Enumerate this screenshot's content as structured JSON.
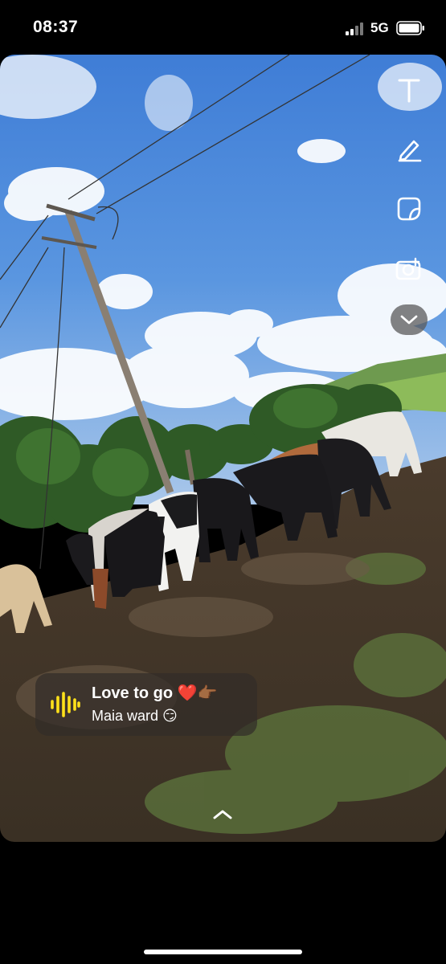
{
  "status_bar": {
    "time": "08:37",
    "network": "5G",
    "icons": [
      "signal-icon",
      "battery-icon"
    ]
  },
  "photo": {
    "description_icons": [
      "sky",
      "power-pole",
      "cattle",
      "mud-field"
    ]
  },
  "toolbar": {
    "tools": [
      {
        "name": "text-tool",
        "icon": "text-icon",
        "glyph": "T"
      },
      {
        "name": "draw-tool",
        "icon": "pencil-icon"
      },
      {
        "name": "sticker-tool",
        "icon": "sticker-icon"
      },
      {
        "name": "camera-tool",
        "icon": "camera-icon"
      },
      {
        "name": "more-tool",
        "icon": "chevron-down-icon"
      }
    ]
  },
  "caption": {
    "title": "Love to go ❤️👉🏾",
    "subtitle": "Maia ward 😏",
    "icon": "audio-waveform-icon",
    "icon_color": "#ffe11a"
  },
  "bottom": {
    "swipe_icon": "chevron-up-icon"
  }
}
